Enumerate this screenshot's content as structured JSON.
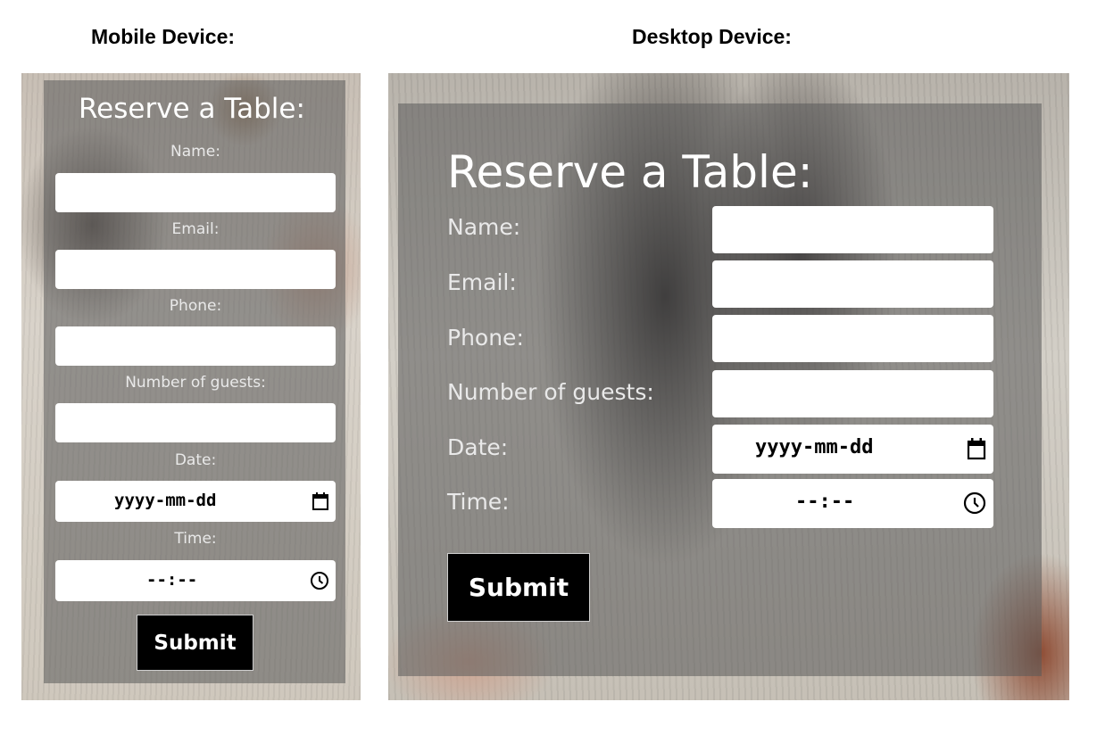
{
  "captions": {
    "mobile": "Mobile Device:",
    "desktop": "Desktop Device:"
  },
  "form": {
    "title": "Reserve a Table:",
    "labels": {
      "name": "Name:",
      "email": "Email:",
      "phone": "Phone:",
      "guests": "Number of guests:",
      "date": "Date:",
      "time": "Time:"
    },
    "date_placeholder": "yyyy-mm-dd",
    "time_placeholder": "--:--",
    "submit": "Submit",
    "icons": {
      "date": "calendar-icon",
      "time": "clock-icon"
    }
  }
}
